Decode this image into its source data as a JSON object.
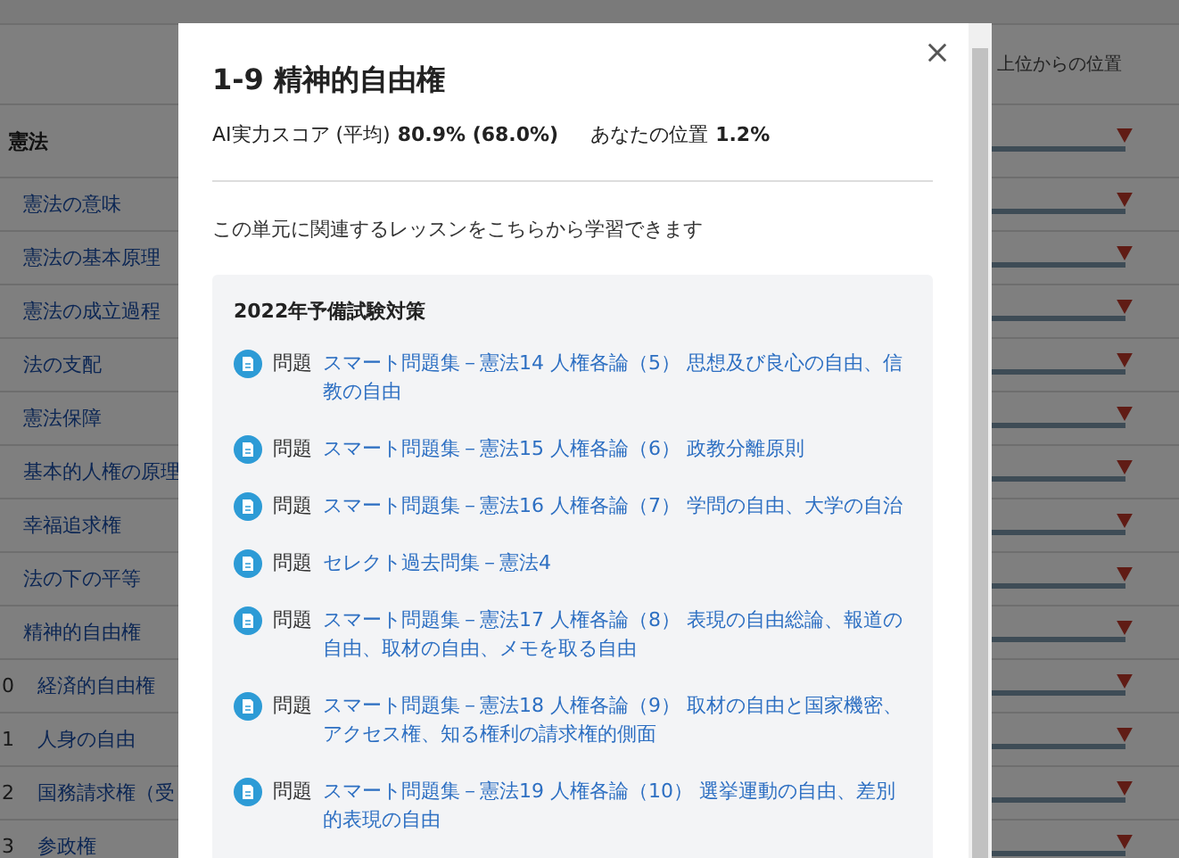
{
  "background": {
    "column_header": "上位からの位置",
    "section": "憲法",
    "rows": [
      {
        "label": "憲法の意味"
      },
      {
        "label": "憲法の基本原理"
      },
      {
        "label": "憲法の成立過程"
      },
      {
        "label": "法の支配"
      },
      {
        "label": "憲法保障"
      },
      {
        "label": "基本的人権の原理"
      },
      {
        "label": "幸福追求権"
      },
      {
        "label": "法の下の平等"
      },
      {
        "label": "精神的自由権"
      },
      {
        "num": "0",
        "label": "経済的自由権"
      },
      {
        "num": "1",
        "label": "人身の自由"
      },
      {
        "num": "2",
        "label": "国務請求権（受"
      },
      {
        "num": "3",
        "label": "参政権"
      }
    ]
  },
  "modal": {
    "title": "1-9 精神的自由権",
    "score_label": "AI実力スコア (平均)",
    "score_value": "80.9% (68.0%)",
    "position_label": "あなたの位置",
    "position_value": "1.2%",
    "intro": "この単元に関連するレッスンをこちらから学習できます",
    "group": {
      "title": "2022年予備試験対策",
      "items": [
        {
          "type": "問題",
          "link": "スマート問題集－憲法14 人権各論（5） 思想及び良心の自由、信教の自由"
        },
        {
          "type": "問題",
          "link": "スマート問題集－憲法15 人権各論（6） 政教分離原則"
        },
        {
          "type": "問題",
          "link": "スマート問題集－憲法16 人権各論（7） 学問の自由、大学の自治"
        },
        {
          "type": "問題",
          "link": "セレクト過去問集－憲法4"
        },
        {
          "type": "問題",
          "link": "スマート問題集－憲法17 人権各論（8） 表現の自由総論、報道の自由、取材の自由、メモを取る自由"
        },
        {
          "type": "問題",
          "link": "スマート問題集－憲法18 人権各論（9） 取材の自由と国家機密、アクセス権、知る権利の請求権的側面"
        },
        {
          "type": "問題",
          "link": "スマート問題集－憲法19 人権各論（10） 選挙運動の自由、差別的表現の自由"
        }
      ]
    }
  }
}
